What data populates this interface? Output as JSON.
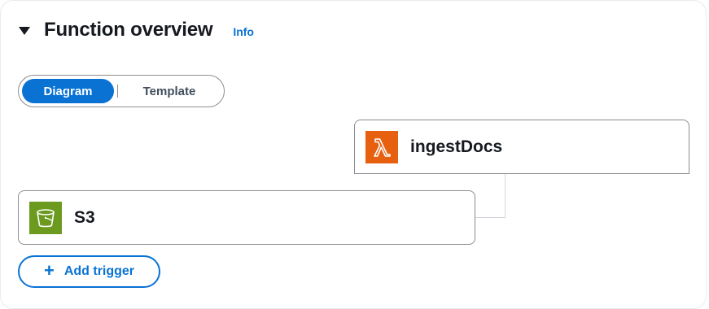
{
  "section": {
    "title": "Function overview",
    "info_label": "Info"
  },
  "view_toggle": {
    "options": [
      "Diagram",
      "Template"
    ],
    "selected": "Diagram"
  },
  "function_node": {
    "name": "ingestDocs",
    "icon": "lambda-icon"
  },
  "trigger_node": {
    "name": "S3",
    "icon": "s3-bucket-icon"
  },
  "add_trigger": {
    "label": "Add trigger",
    "icon": "plus-icon"
  },
  "colors": {
    "accent": "#0972d3",
    "lambda": "#e7600f",
    "s3": "#6b9a1f"
  }
}
